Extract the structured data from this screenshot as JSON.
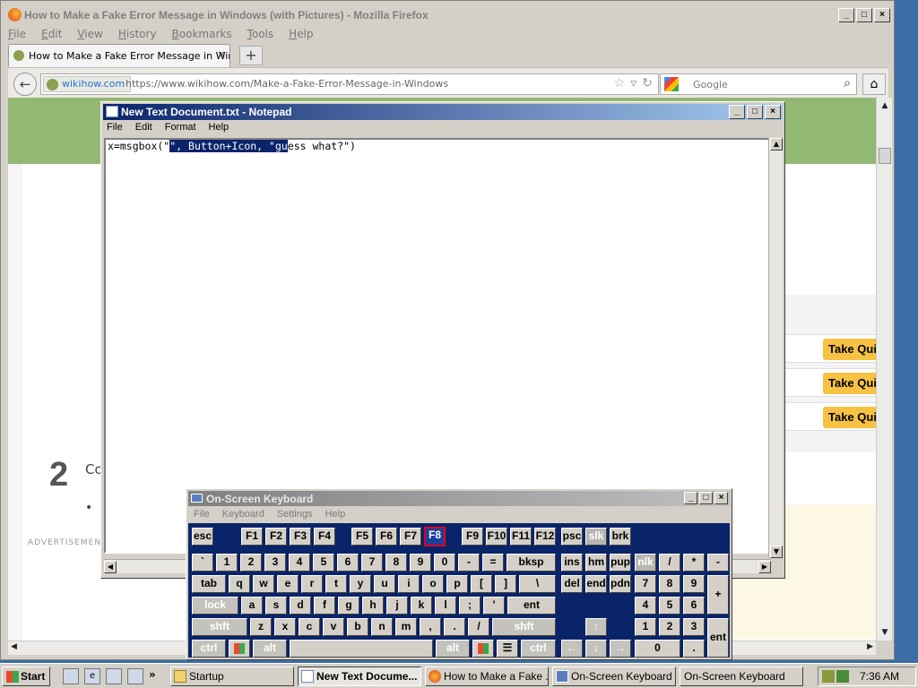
{
  "firefox": {
    "window_title": "How to Make a Fake Error Message in Windows (with Pictures) - Mozilla Firefox",
    "menu": [
      "File",
      "Edit",
      "View",
      "History",
      "Bookmarks",
      "Tools",
      "Help"
    ],
    "tab_title": "How to Make a Fake Error Message in Windo...",
    "new_tab": "+",
    "identity": "wikihow.com",
    "url": "https://www.wikihow.com/Make-a-Fake-Error-Message-in-Windows",
    "search_engine": "Google",
    "page": {
      "quiz_label": "Take Quiz",
      "step_number": "2",
      "step_text": "Co",
      "bullet": "•",
      "advertisement": "ADVERTISEMENT"
    }
  },
  "notepad": {
    "title": "New Text Document.txt - Notepad",
    "menu": [
      "File",
      "Edit",
      "Format",
      "Help"
    ],
    "text_before": "x=msgbox(\"",
    "text_selected": "\", Button+Icon, \"gu",
    "text_after": "ess what?\")"
  },
  "osk": {
    "title": "On-Screen Keyboard",
    "menu": [
      "File",
      "Keyboard",
      "Settings",
      "Help"
    ],
    "pressed_key": "F8",
    "keys": {
      "esc": "esc",
      "f1": "F1",
      "f2": "F2",
      "f3": "F3",
      "f4": "F4",
      "f5": "F5",
      "f6": "F6",
      "f7": "F7",
      "f8": "F8",
      "f9": "F9",
      "f10": "F10",
      "f11": "F11",
      "f12": "F12",
      "psc": "psc",
      "slk": "slk",
      "brk": "brk",
      "grave": "`",
      "n1": "1",
      "n2": "2",
      "n3": "3",
      "n4": "4",
      "n5": "5",
      "n6": "6",
      "n7": "7",
      "n8": "8",
      "n9": "9",
      "n0": "0",
      "minus": "-",
      "equals": "=",
      "bksp": "bksp",
      "ins": "ins",
      "hm": "hm",
      "pup": "pup",
      "nlk": "nlk",
      "kdiv": "/",
      "kmul": "*",
      "ksub": "-",
      "tab": "tab",
      "q": "q",
      "w": "w",
      "e": "e",
      "r": "r",
      "t": "t",
      "y": "y",
      "u": "u",
      "i": "i",
      "o": "o",
      "p": "p",
      "lbr": "[",
      "rbr": "]",
      "bslash": "\\",
      "del": "del",
      "end": "end",
      "pdn": "pdn",
      "k7": "7",
      "k8": "8",
      "k9": "9",
      "kadd": "+",
      "lock": "lock",
      "a": "a",
      "s": "s",
      "d": "d",
      "f": "f",
      "g": "g",
      "h": "h",
      "j": "j",
      "k": "k",
      "l": "l",
      "semi": ";",
      "quote": "'",
      "ent": "ent",
      "k4": "4",
      "k5": "5",
      "k6": "6",
      "shft": "shft",
      "z": "z",
      "x": "x",
      "c": "c",
      "v": "v",
      "b": "b",
      "n": "n",
      "m": "m",
      "comma": ",",
      "period": ".",
      "slash": "/",
      "up": "↑",
      "k1": "1",
      "k2": "2",
      "k3": "3",
      "kent": "ent",
      "ctrl": "ctrl",
      "alt": "alt",
      "left": "←",
      "down": "↓",
      "right": "→",
      "k0": "0",
      "kdot": "."
    }
  },
  "taskbar": {
    "start": "Start",
    "more": "»",
    "buttons": [
      "Startup",
      "New Text Docume...",
      "How to Make a Fake ...",
      "On-Screen Keyboard",
      "On-Screen Keyboard"
    ],
    "clock": "7:36 AM"
  }
}
